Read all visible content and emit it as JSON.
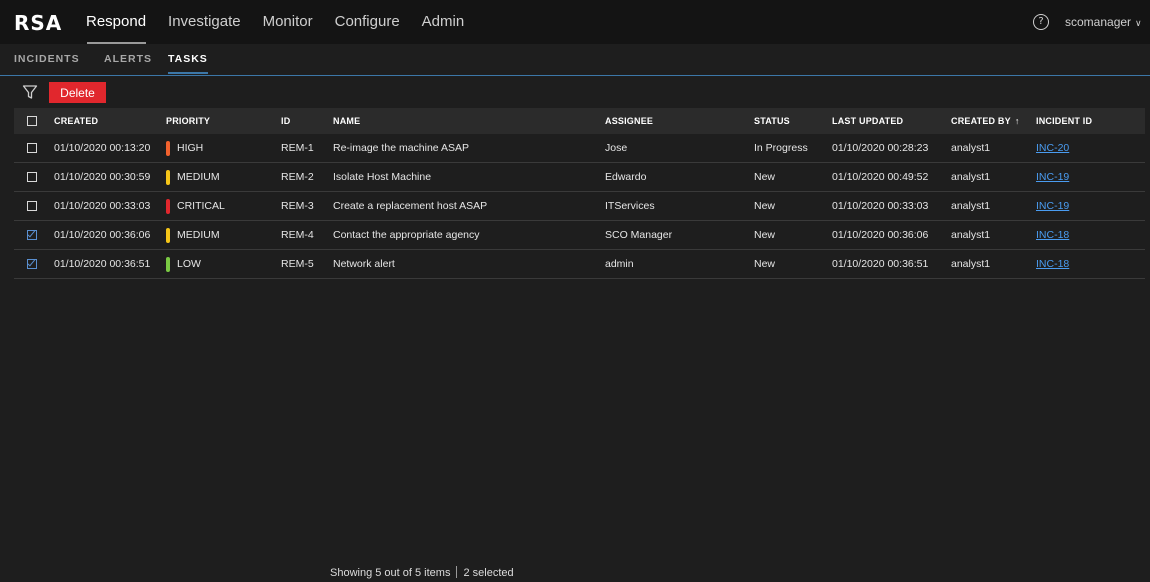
{
  "app": {
    "logo": "RSA"
  },
  "main_nav": [
    {
      "label": "Respond",
      "active": true
    },
    {
      "label": "Investigate",
      "active": false
    },
    {
      "label": "Monitor",
      "active": false
    },
    {
      "label": "Configure",
      "active": false
    },
    {
      "label": "Admin",
      "active": false
    }
  ],
  "user": {
    "name": "scomanager",
    "help_icon": "question-circle-icon"
  },
  "sub_nav": [
    {
      "label": "INCIDENTS",
      "active": false
    },
    {
      "label": "ALERTS",
      "active": false
    },
    {
      "label": "TASKS",
      "active": true
    }
  ],
  "toolbar": {
    "filter_icon": "filter-icon",
    "delete_label": "Delete"
  },
  "table": {
    "headers": {
      "created": "CREATED",
      "priority": "PRIORITY",
      "id": "ID",
      "name": "NAME",
      "assignee": "ASSIGNEE",
      "status": "STATUS",
      "last_updated": "LAST UPDATED",
      "created_by": "CREATED BY",
      "created_by_sort": "↑",
      "incident_id": "INCIDENT ID"
    },
    "rows": [
      {
        "checked": false,
        "created": "01/10/2020 00:13:20",
        "priority": "HIGH",
        "priority_color": "#f2622e",
        "id": "REM-1",
        "name": "Re-image the machine ASAP",
        "assignee": "Jose",
        "status": "In Progress",
        "last_updated": "01/10/2020 00:28:23",
        "created_by": "analyst1",
        "incident_id": "INC-20"
      },
      {
        "checked": false,
        "created": "01/10/2020 00:30:59",
        "priority": "MEDIUM",
        "priority_color": "#f5c518",
        "id": "REM-2",
        "name": "Isolate Host Machine",
        "assignee": "Edwardo",
        "status": "New",
        "last_updated": "01/10/2020 00:49:52",
        "created_by": "analyst1",
        "incident_id": "INC-19"
      },
      {
        "checked": false,
        "created": "01/10/2020 00:33:03",
        "priority": "CRITICAL",
        "priority_color": "#e1272d",
        "id": "REM-3",
        "name": "Create a replacement host ASAP",
        "assignee": "ITServices",
        "status": "New",
        "last_updated": "01/10/2020 00:33:03",
        "created_by": "analyst1",
        "incident_id": "INC-19"
      },
      {
        "checked": true,
        "created": "01/10/2020 00:36:06",
        "priority": "MEDIUM",
        "priority_color": "#f5c518",
        "id": "REM-4",
        "name": "Contact the appropriate agency",
        "assignee": "SCO Manager",
        "status": "New",
        "last_updated": "01/10/2020 00:36:06",
        "created_by": "analyst1",
        "incident_id": "INC-18"
      },
      {
        "checked": true,
        "created": "01/10/2020 00:36:51",
        "priority": "LOW",
        "priority_color": "#7ac943",
        "id": "REM-5",
        "name": "Network alert",
        "assignee": "admin",
        "status": "New",
        "last_updated": "01/10/2020 00:36:51",
        "created_by": "analyst1",
        "incident_id": "INC-18"
      }
    ]
  },
  "footer": {
    "showing": "Showing 5 out of 5 items",
    "selected": "2 selected"
  }
}
